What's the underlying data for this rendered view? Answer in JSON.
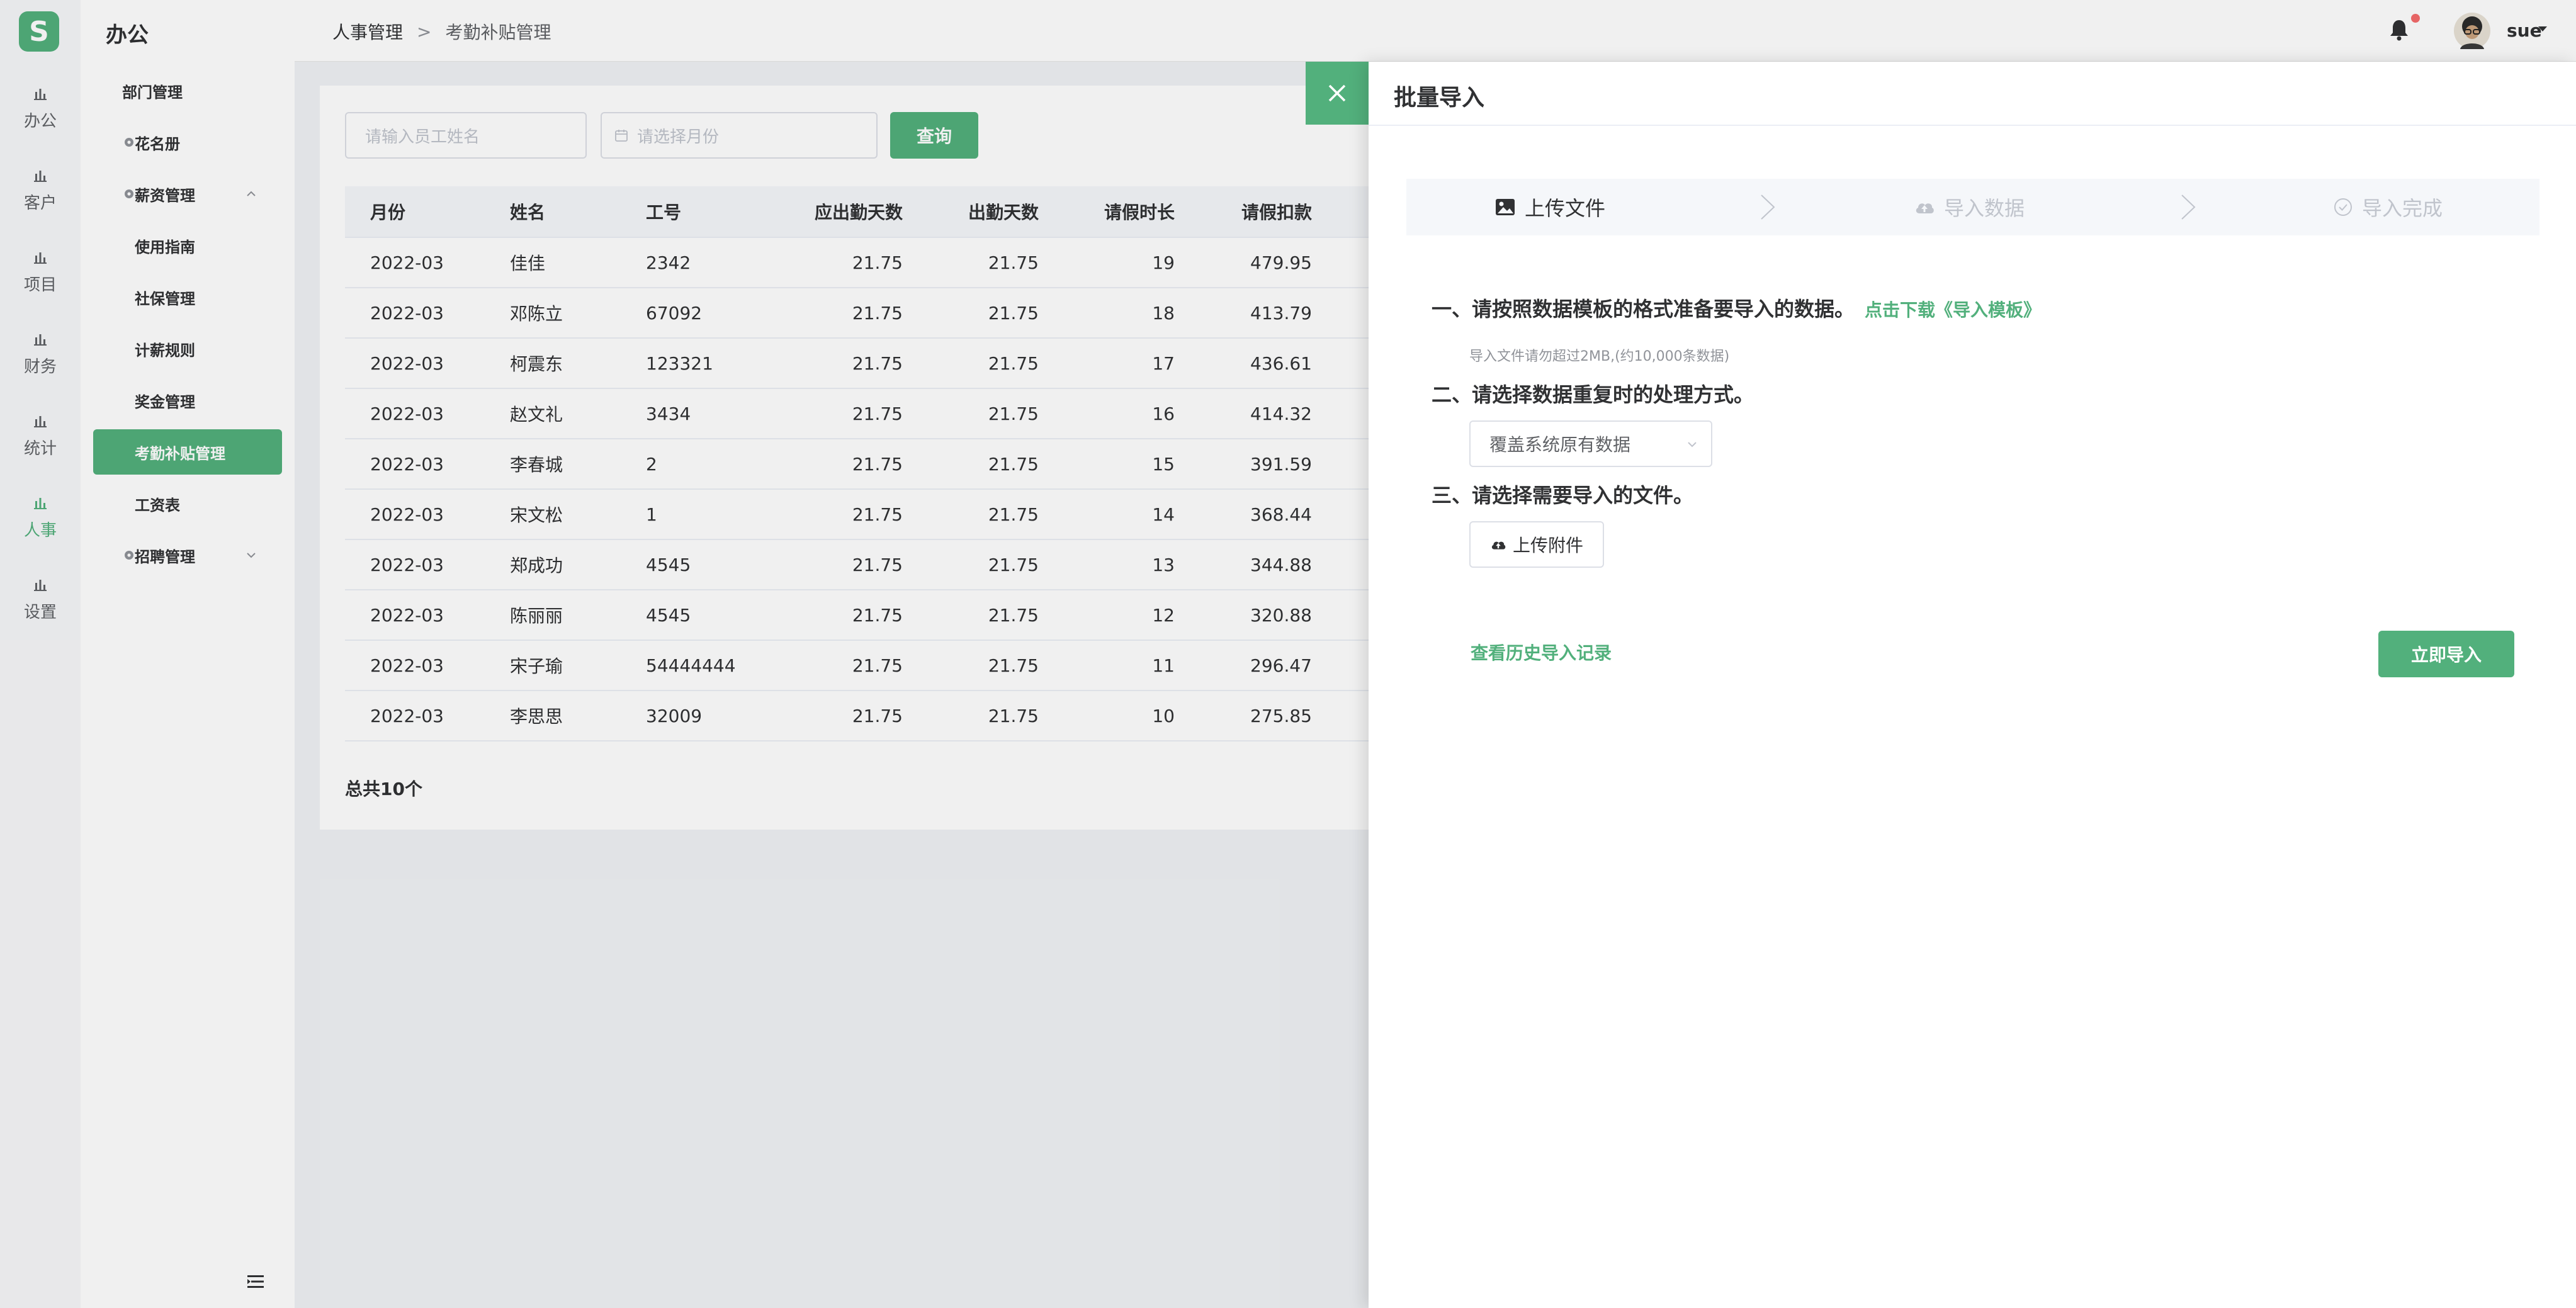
{
  "logo": {
    "letter": "S",
    "color": "#52b07c"
  },
  "rail": {
    "items": [
      {
        "label": "办公",
        "icon": "bar-chart-icon"
      },
      {
        "label": "客户",
        "icon": "bar-chart-icon"
      },
      {
        "label": "项目",
        "icon": "bar-chart-icon"
      },
      {
        "label": "财务",
        "icon": "bar-chart-icon"
      },
      {
        "label": "统计",
        "icon": "bar-chart-icon"
      },
      {
        "label": "人事",
        "icon": "bar-chart-icon",
        "active": true
      },
      {
        "label": "设置",
        "icon": "bar-chart-icon"
      }
    ]
  },
  "nav": {
    "title": "办公",
    "items": [
      {
        "label": "部门管理"
      },
      {
        "label": "花名册",
        "icon": "gear-icon"
      },
      {
        "label": "薪资管理",
        "icon": "gear-icon",
        "expanded": true
      },
      {
        "label": "使用指南"
      },
      {
        "label": "社保管理"
      },
      {
        "label": "计薪规则"
      },
      {
        "label": "奖金管理"
      },
      {
        "label": "考勤补贴管理",
        "active": true
      },
      {
        "label": "工资表"
      },
      {
        "label": "招聘管理",
        "icon": "gear-icon",
        "expanded": false
      }
    ]
  },
  "header": {
    "breadcrumb": [
      "人事管理",
      "考勤补贴管理"
    ],
    "breadcrumb_sep": ">",
    "user": "sue",
    "notification_dot_color": "#f56c6c"
  },
  "search": {
    "name_placeholder": "请输入员工姓名",
    "month_placeholder": "请选择月份",
    "query_label": "查询"
  },
  "table": {
    "columns": [
      "月份",
      "姓名",
      "工号",
      "应出勤天数",
      "出勤天数",
      "请假时长",
      "请假扣款"
    ],
    "rows": [
      [
        "2022-03",
        "佳佳",
        "2342",
        "21.75",
        "21.75",
        "19",
        "479.95"
      ],
      [
        "2022-03",
        "邓陈立",
        "67092",
        "21.75",
        "21.75",
        "18",
        "413.79"
      ],
      [
        "2022-03",
        "柯震东",
        "123321",
        "21.75",
        "21.75",
        "17",
        "436.61"
      ],
      [
        "2022-03",
        "赵文礼",
        "3434",
        "21.75",
        "21.75",
        "16",
        "414.32"
      ],
      [
        "2022-03",
        "李春城",
        "2",
        "21.75",
        "21.75",
        "15",
        "391.59"
      ],
      [
        "2022-03",
        "宋文松",
        "1",
        "21.75",
        "21.75",
        "14",
        "368.44"
      ],
      [
        "2022-03",
        "郑成功",
        "4545",
        "21.75",
        "21.75",
        "13",
        "344.88"
      ],
      [
        "2022-03",
        "陈丽丽",
        "4545",
        "21.75",
        "21.75",
        "12",
        "320.88"
      ],
      [
        "2022-03",
        "宋子瑜",
        "54444444",
        "21.75",
        "21.75",
        "11",
        "296.47"
      ],
      [
        "2022-03",
        "李思思",
        "32009",
        "21.75",
        "21.75",
        "10",
        "275.85"
      ]
    ],
    "total": "总共10个"
  },
  "drawer": {
    "title": "批量导入",
    "steps": [
      {
        "label": "上传文件",
        "icon": "image-icon",
        "active": true
      },
      {
        "label": "导入数据",
        "icon": "cloud-upload-icon",
        "active": false
      },
      {
        "label": "导入完成",
        "icon": "check-circle-icon",
        "active": false
      }
    ],
    "section1": "一、请按照数据模板的格式准备要导入的数据。",
    "template_link": "点击下载《导入模板》",
    "hint": "导入文件请勿超过2MB,(约10,000条数据)",
    "section2": "二、请选择数据重复时的处理方式。",
    "duplicate_option": "覆盖系统原有数据",
    "section3": "三、请选择需要导入的文件。",
    "upload_label": "上传附件",
    "history_link": "查看历史导入记录",
    "import_label": "立即导入"
  },
  "colors": {
    "accent": "#52b07c",
    "muted": "#c0c4cc"
  }
}
